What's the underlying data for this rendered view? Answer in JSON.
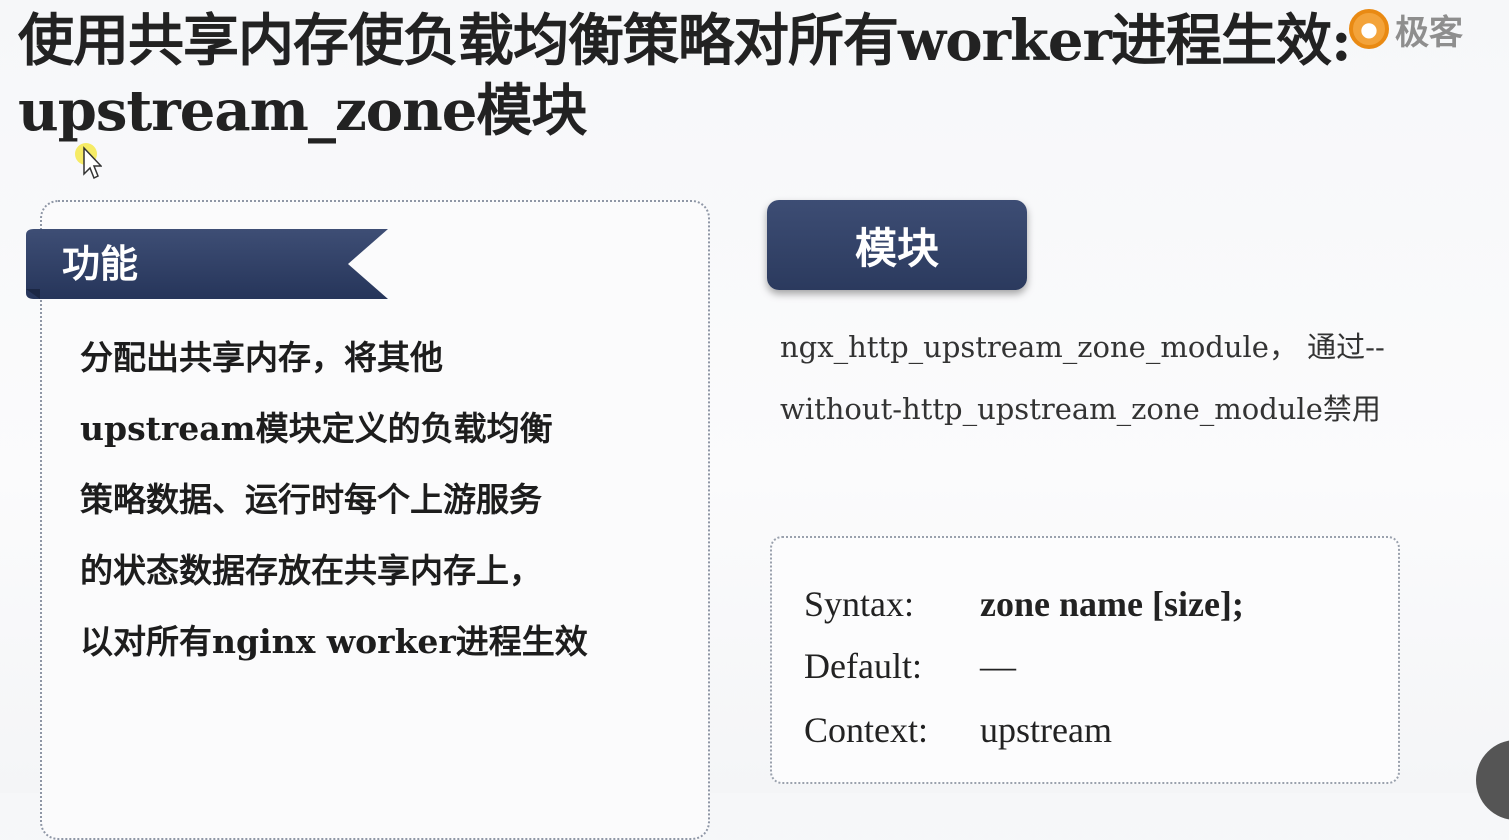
{
  "title": {
    "line1": "使用共享内存使负载均衡策略对所有worker进程生效:",
    "line2": "upstream_zone模块"
  },
  "logo": {
    "name": "极客"
  },
  "function_panel": {
    "label": "功能",
    "lines": [
      "分配出共享内存，将其他",
      "upstream模块定义的负载均衡",
      "策略数据、运行时每个上游服务",
      "的状态数据存放在共享内存上，",
      "以对所有nginx worker进程生效"
    ]
  },
  "module_panel": {
    "label": "模块",
    "lines": [
      "ngx_http_upstream_zone_module， 通过--",
      "without-http_upstream_zone_module禁用"
    ]
  },
  "syntax": {
    "syntax_key": "Syntax:",
    "syntax_val": "zone name [size];",
    "default_key": "Default:",
    "default_val": "—",
    "context_key": "Context:",
    "context_val": "upstream"
  },
  "colors": {
    "accent_navy": "#2f3e63",
    "logo_orange": "#f3a33a"
  }
}
